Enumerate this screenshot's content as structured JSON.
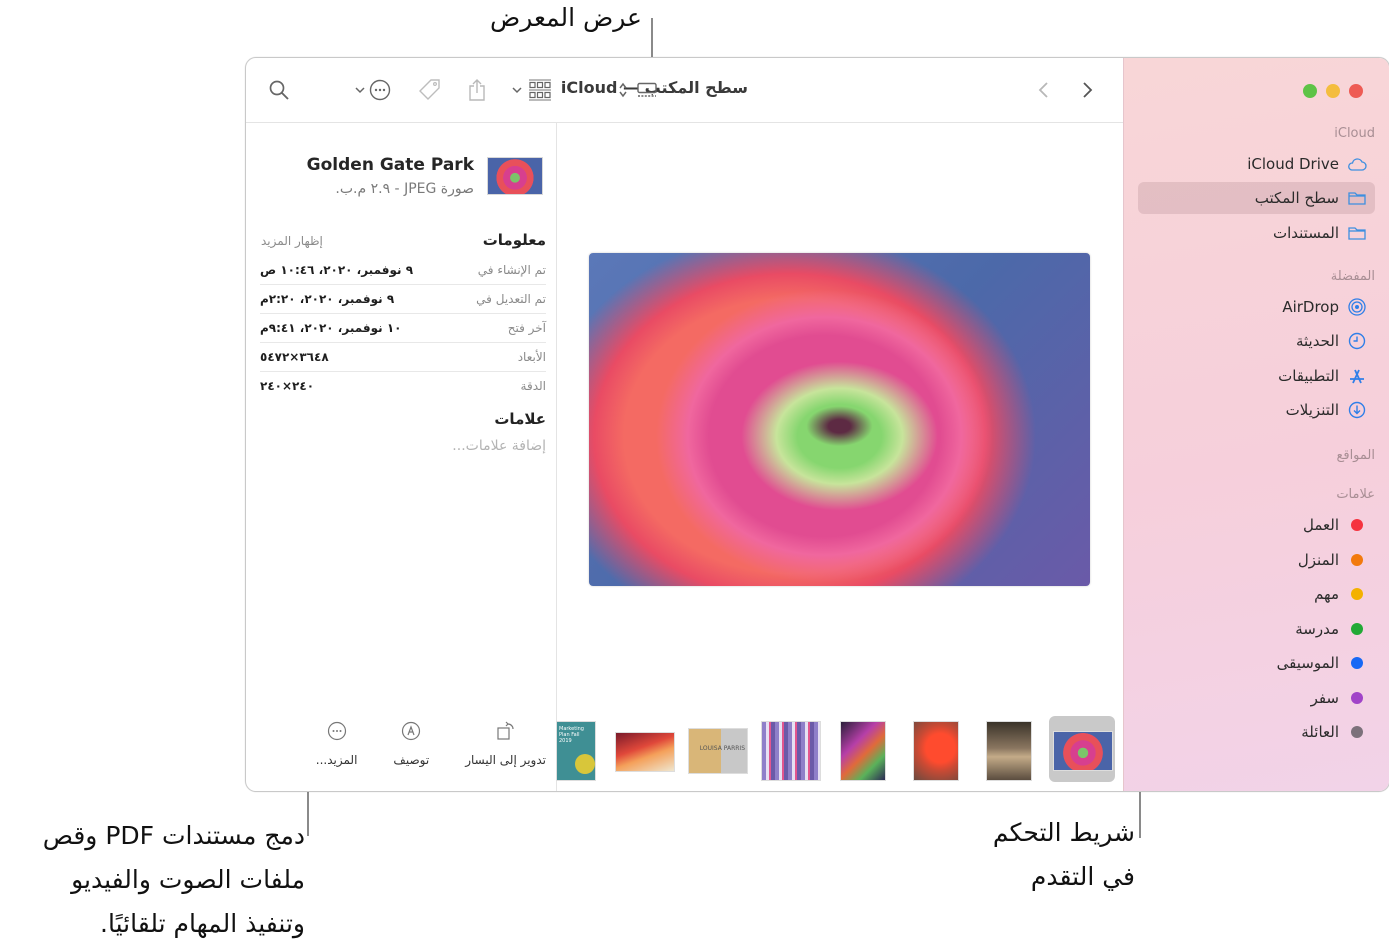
{
  "callouts": {
    "gallery_view": "عرض المعرض",
    "quick_actions": [
      "دمج مستندات PDF وقص",
      "ملفات الصوت والفيديو",
      "وتنفيذ المهام تلقائيًا."
    ],
    "scrubber": [
      "شريط التحكم",
      "في التقدم"
    ]
  },
  "window": {
    "title": "سطح المكتب — iCloud",
    "toolbar": {
      "back_icon": "chevron-left-icon",
      "forward_icon": "chevron-right-icon",
      "view_icon": "gallery-view-icon",
      "group_icon": "group-grid-icon",
      "share_icon": "share-icon",
      "tag_icon": "tag-icon",
      "action_icon": "more-circle-icon",
      "search_icon": "search-icon"
    }
  },
  "sidebar": {
    "traffic_lights": {
      "close": "#ee5b54",
      "minimize": "#f4bd3e",
      "zoom": "#5ec346"
    },
    "sections": [
      {
        "title": "iCloud",
        "items": [
          {
            "label": "iCloud Drive",
            "icon": "cloud-icon",
            "selected": false
          },
          {
            "label": "سطح المكتب",
            "icon": "folder-icon",
            "selected": true
          },
          {
            "label": "المستندات",
            "icon": "folder-icon",
            "selected": false
          }
        ]
      },
      {
        "title": "المفضلة",
        "items": [
          {
            "label": "AirDrop",
            "icon": "airdrop-icon"
          },
          {
            "label": "الحديثة",
            "icon": "clock-icon"
          },
          {
            "label": "التطبيقات",
            "icon": "applications-icon"
          },
          {
            "label": "التنزيلات",
            "icon": "download-icon"
          }
        ]
      },
      {
        "title": "المواقع",
        "items": []
      },
      {
        "title": "علامات",
        "items": [
          {
            "label": "العمل",
            "color": "#f5333f"
          },
          {
            "label": "المنزل",
            "color": "#f27a0d"
          },
          {
            "label": "مهم",
            "color": "#f3b100"
          },
          {
            "label": "مدرسة",
            "color": "#22a936"
          },
          {
            "label": "الموسيقى",
            "color": "#1768f5"
          },
          {
            "label": "سفر",
            "color": "#a144c8"
          },
          {
            "label": "العائلة",
            "color": "#7c717b"
          }
        ]
      }
    ]
  },
  "inspector": {
    "file_name": "Golden Gate Park",
    "file_sub": "صورة JPEG - ٢.٩ م.ب.",
    "info_title": "معلومات",
    "show_more": "إظهار المزيد",
    "rows": [
      {
        "key": "تم الإنشاء في",
        "value": "٩ نوفمبر، ٢٠٢٠، ١٠:٤٦ ص"
      },
      {
        "key": "تم التعديل في",
        "value": "٩ نوفمبر، ٢٠٢٠، ٢:٢٠م"
      },
      {
        "key": "آخر فتح",
        "value": "١٠ نوفمبر، ٢٠٢٠، ٩:٤١م"
      },
      {
        "key": "الأبعاد",
        "value": "٣٦٤٨×٥٤٧٢"
      },
      {
        "key": "الدقة",
        "value": "٢٤٠×٢٤٠"
      }
    ],
    "tags_title": "علامات",
    "tags_placeholder": "إضافة علامات...",
    "actions": [
      {
        "label": "تدوير إلى اليسار",
        "icon": "rotate-left-icon"
      },
      {
        "label": "توصيف",
        "icon": "markup-icon"
      },
      {
        "label": "المزيد...",
        "icon": "more-circle-icon"
      }
    ]
  },
  "gallery": {
    "selected_index": 0,
    "thumbnails": [
      {
        "name": "flower",
        "selected": true
      },
      {
        "name": "cyclists-road"
      },
      {
        "name": "red-hand-shadow"
      },
      {
        "name": "neon-portrait"
      },
      {
        "name": "striped-lights"
      },
      {
        "name": "louisa-parris"
      },
      {
        "name": "abstract-gradient"
      },
      {
        "name": "marketing-plan"
      }
    ],
    "marketing_thumb_text": "Marketing Plan Fall 2019",
    "louisa_thumb_text": "LOUISA PARRIS"
  }
}
